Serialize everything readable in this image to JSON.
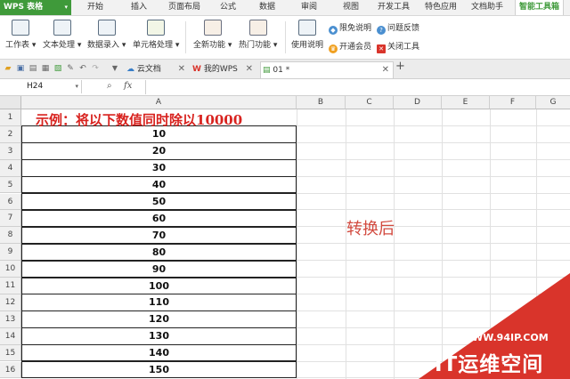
{
  "app": {
    "logo_text": "WPS 表格"
  },
  "menu_tabs": [
    "开始",
    "插入",
    "页面布局",
    "公式",
    "数据",
    "审阅",
    "视图",
    "开发工具",
    "特色应用",
    "文档助手",
    "智能工具箱"
  ],
  "ribbon": {
    "groups": [
      {
        "label": "工作表 ▾",
        "icon": "worksheet-icon"
      },
      {
        "label": "文本处理 ▾",
        "icon": "text-process-icon"
      },
      {
        "label": "数据录入 ▾",
        "icon": "data-entry-icon"
      },
      {
        "label": "单元格处理 ▾",
        "icon": "cell-process-icon"
      },
      {
        "label": "全新功能 ▾",
        "icon": "new-feature-icon"
      },
      {
        "label": "热门功能 ▾",
        "icon": "hot-feature-icon"
      },
      {
        "label": "使用说明",
        "icon": "manual-icon"
      }
    ],
    "side": {
      "free_desc": "限免说明",
      "feedback": "问题反馈",
      "vip": "开通会员",
      "close_tool": "关闭工具"
    }
  },
  "doc_tabs": [
    {
      "label": "云文档",
      "icon": "cloud-icon"
    },
    {
      "label": "我的WPS",
      "icon": "wps-icon"
    },
    {
      "label": "01 *",
      "icon": "sheet-file-icon"
    }
  ],
  "formula_bar": {
    "cell_ref": "H24",
    "fx": "fx",
    "zoom_icon": "magnifier-icon"
  },
  "columns": [
    "A",
    "B",
    "C",
    "D",
    "E",
    "F",
    "G"
  ],
  "rows": [
    "1",
    "2",
    "3",
    "4",
    "5",
    "6",
    "7",
    "8",
    "9",
    "10",
    "11",
    "12",
    "13",
    "14",
    "15",
    "16"
  ],
  "cells": {
    "title": "示例：将以下数值同时除以10000",
    "values": [
      "10",
      "20",
      "30",
      "40",
      "50",
      "60",
      "70",
      "80",
      "90",
      "100",
      "110",
      "120",
      "130",
      "140",
      "150"
    ],
    "after_label": "转换后"
  },
  "watermark": {
    "url": "WWW.94IP.COM",
    "name": "IT运维空间"
  },
  "colors": {
    "brand_green": "#3f9a3a",
    "title_red": "#d8231f",
    "watermark_red": "#d9342b"
  }
}
